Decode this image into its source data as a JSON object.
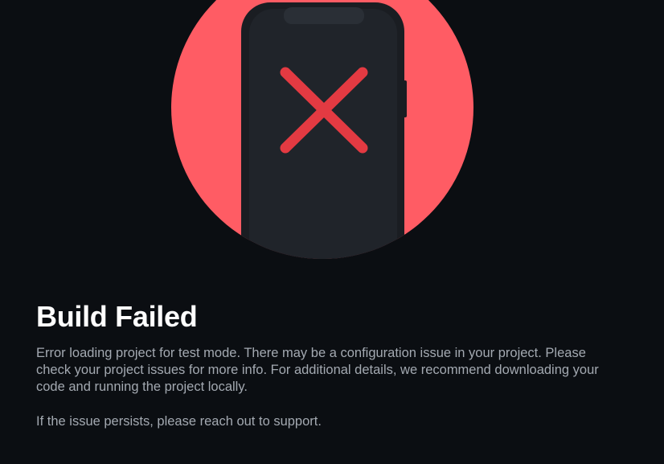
{
  "error": {
    "title": "Build Failed",
    "message": "Error loading project for test mode. There may be a configuration issue in your project. Please check your project issues for more info. For additional details, we recommend downloading your code and running the project locally.",
    "support_text": "If the issue persists, please reach out to support."
  },
  "illustration": {
    "icon": "phone-error-icon",
    "circle_color": "#ff5c64",
    "phone_color": "#20242a",
    "cross_color": "#e33a42"
  },
  "background_color": "#0b0e12"
}
